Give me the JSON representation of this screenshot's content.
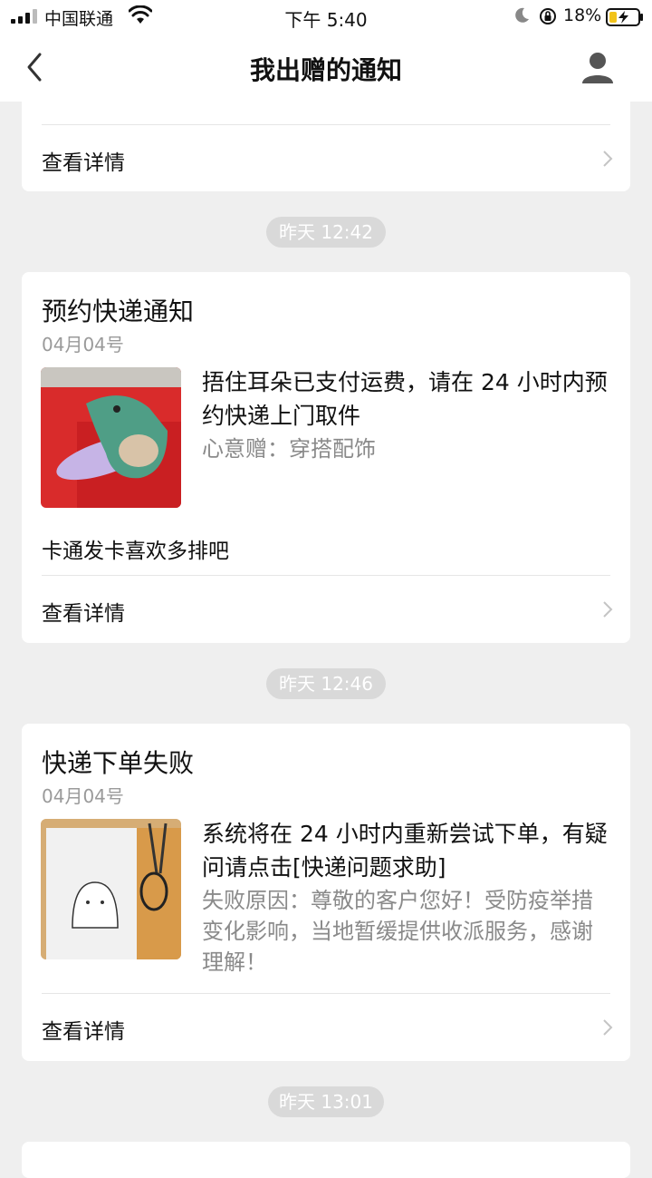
{
  "status_bar": {
    "carrier": "中国联通",
    "time": "下午 5:40",
    "battery": "18%"
  },
  "nav": {
    "title": "我出赠的通知",
    "back_icon": "chevron-left-icon",
    "profile_icon": "user-icon"
  },
  "card0": {
    "detail_label": "查看详情"
  },
  "timestamps": [
    "昨天 12:42",
    "昨天 12:46",
    "昨天 13:01"
  ],
  "card1": {
    "title": "预约快递通知",
    "date": "04月04号",
    "message": "捂住耳朵已支付运费，请在 24 小时内预约快递上门取件",
    "sub": "心意赠：穿搭配饰",
    "desc": "卡通发卡喜欢多排吧",
    "detail_label": "查看详情"
  },
  "card2": {
    "title": "快递下单失败",
    "date": "04月04号",
    "message": "系统将在 24 小时内重新尝试下单，有疑问请点击[快递问题求助]",
    "sub": "失败原因：尊敬的客户您好！受防疫举措变化影响，当地暂缓提供收派服务，感谢理解！",
    "detail_label": "查看详情"
  },
  "colors": {
    "background": "#efefef",
    "card": "#ffffff",
    "timestamp_pill": "#d9d9d9",
    "secondary_text": "#8a8a8a"
  }
}
